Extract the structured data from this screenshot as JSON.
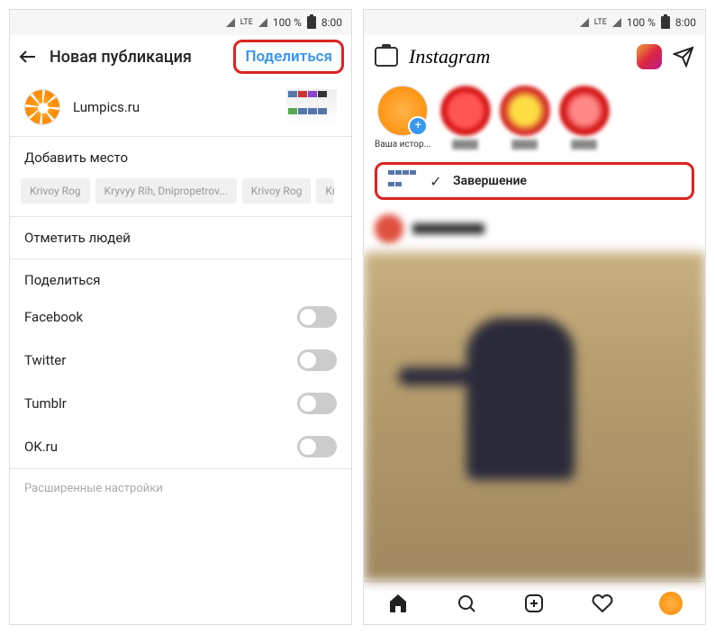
{
  "statusbar": {
    "lte": "LTE",
    "signal": "100 %",
    "time": "8:00"
  },
  "left": {
    "title": "Новая публикация",
    "share_button": "Поделиться",
    "username": "Lumpics.ru",
    "add_location": "Добавить место",
    "chips": [
      "Krivoy Rog",
      "Kryvyy Rih, Dnipropetrov...",
      "Krivoy Rog",
      "Kr"
    ],
    "tag_people": "Отметить людей",
    "share_section": "Поделиться",
    "networks": [
      "Facebook",
      "Twitter",
      "Tumblr",
      "OK.ru"
    ],
    "advanced": "Расширенные настройки"
  },
  "right": {
    "logo": "Instagram",
    "story_label": "Ваша истор...",
    "done": "Завершение"
  }
}
